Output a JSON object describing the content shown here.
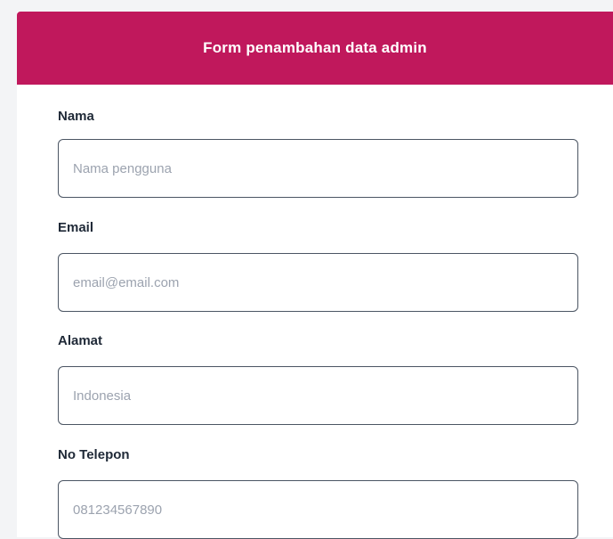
{
  "form": {
    "title": "Form penambahan data admin",
    "header_color": "#c0185c",
    "fields": [
      {
        "label": "Nama",
        "value": "",
        "placeholder": "Nama pengguna"
      },
      {
        "label": "Email",
        "value": "",
        "placeholder": "email@email.com"
      },
      {
        "label": "Alamat",
        "value": "",
        "placeholder": "Indonesia"
      },
      {
        "label": "No Telepon",
        "value": "",
        "placeholder": "081234567890"
      }
    ]
  }
}
